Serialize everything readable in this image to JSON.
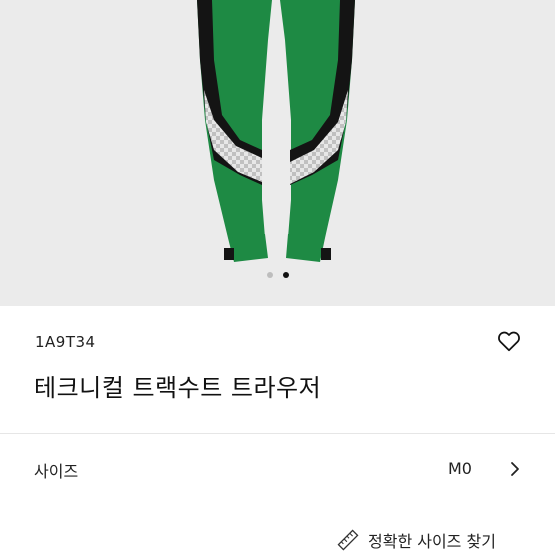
{
  "carousel": {
    "image_alt": "green-black track pants",
    "dots": [
      false,
      true
    ]
  },
  "product": {
    "code": "1A9T34",
    "name": "테크니컬 트랙수트 트라우저",
    "favorite_icon": "heart-outline-icon"
  },
  "size_selector": {
    "label": "사이즈",
    "value": "M0",
    "chevron_icon": "chevron-right-icon"
  },
  "size_guide": {
    "label": "정확한 사이즈 찾기",
    "icon": "ruler-icon"
  },
  "colors": {
    "pants_green": "#1e8a44",
    "pants_black": "#141414",
    "checker_light": "#dcdcdc",
    "background": "#ebebeb"
  }
}
